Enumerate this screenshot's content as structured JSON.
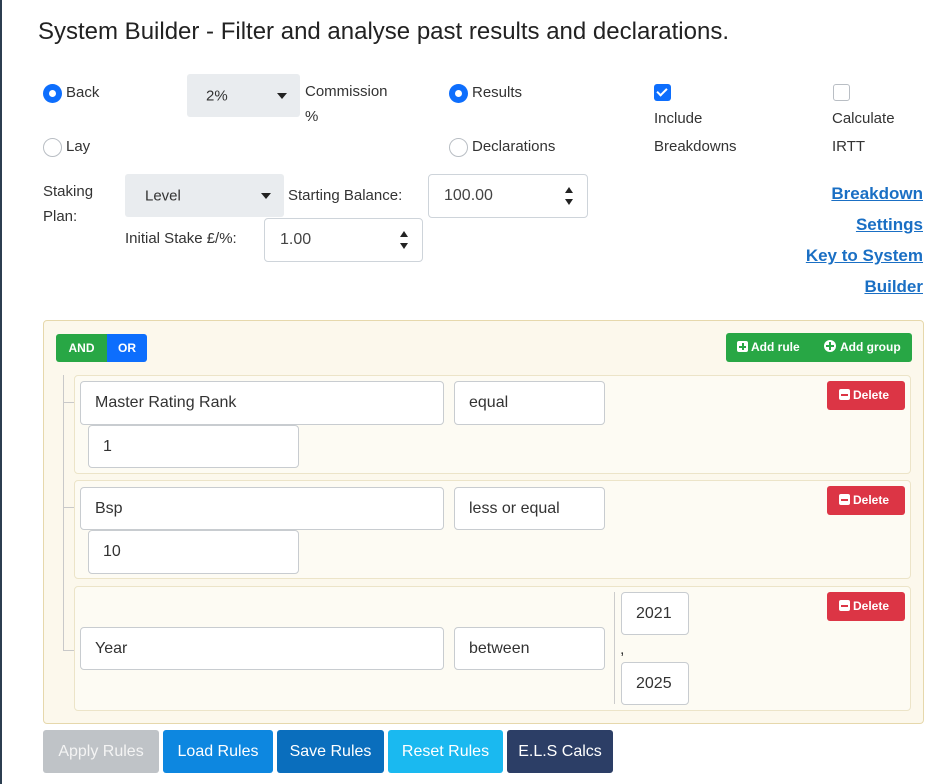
{
  "title": "System Builder - Filter and analyse past results and declarations.",
  "bet_type": {
    "back_label": "Back",
    "lay_label": "Lay",
    "selected": "Back"
  },
  "commission": {
    "value": "2%",
    "label_line1": "Commission",
    "label_line2": "%"
  },
  "data_source": {
    "results_label": "Results",
    "declarations_label": "Declarations",
    "selected": "Results"
  },
  "options": {
    "include_breakdowns": {
      "line1": "Include",
      "line2": "Breakdowns",
      "checked": true
    },
    "calculate_irtt": {
      "line1": "Calculate",
      "line2": "IRTT",
      "checked": false
    }
  },
  "staking": {
    "label_line1": "Staking",
    "label_line2": "Plan:",
    "plan_value": "Level",
    "starting_balance_label": "Starting Balance:",
    "starting_balance_value": "100.00",
    "initial_stake_label": "Initial Stake £/%:",
    "initial_stake_value": "1.00"
  },
  "links": {
    "breakdown_line1": "Breakdown",
    "breakdown_line2": "Settings",
    "key_line1": "Key to System",
    "key_line2": "Builder"
  },
  "query_builder": {
    "and_label": "AND",
    "or_label": "OR",
    "add_rule_label": "Add rule",
    "add_group_label": "Add group",
    "delete_label": "Delete",
    "rules": [
      {
        "field": "Master Rating Rank",
        "operator": "equal",
        "value": "1"
      },
      {
        "field": "Bsp",
        "operator": "less or equal",
        "value": "10"
      },
      {
        "field": "Year",
        "operator": "between",
        "value_from": "2021",
        "separator": ",",
        "value_to": "2025"
      }
    ]
  },
  "footer": {
    "apply_label": "Apply Rules",
    "load_label": "Load Rules",
    "save_label": "Save Rules",
    "reset_label": "Reset Rules",
    "els_label": "E.L.S Calcs"
  },
  "colors": {
    "primary": "#0d6efd",
    "success": "#28a745",
    "danger": "#dc3545",
    "link": "#1a6fc4",
    "builder_bg": "#fcf8ec"
  }
}
